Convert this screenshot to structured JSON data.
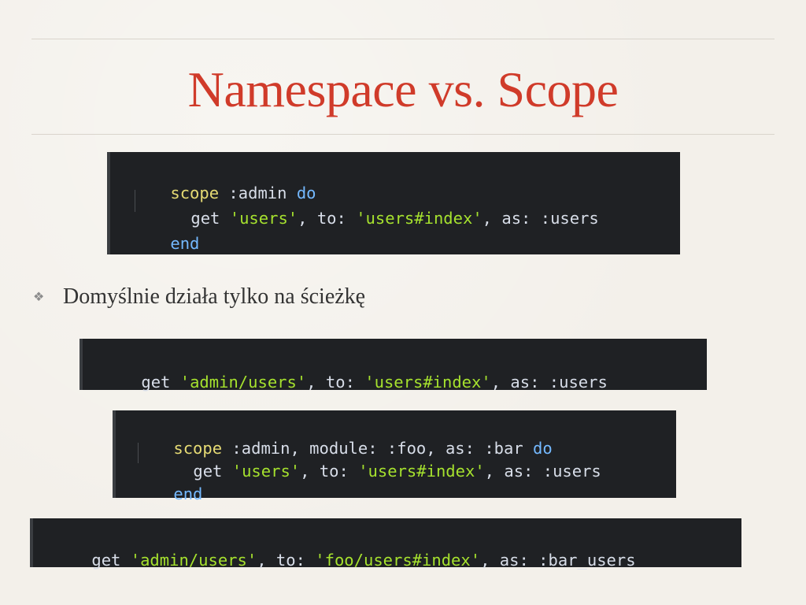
{
  "slide": {
    "title": "Namespace vs. Scope",
    "bullet": "Domyślnie działa tylko na ścieżkę",
    "bullet_marker": "❖"
  },
  "code1": {
    "line1": {
      "a": "scope",
      "b": " :admin ",
      "c": "do"
    },
    "line2": {
      "a": "get ",
      "b": "'users'",
      "c": ", to: ",
      "d": "'users#index'",
      "e": ", as: :users"
    },
    "line3": {
      "a": "end"
    }
  },
  "code2": {
    "line1": {
      "a": "get ",
      "b": "'admin/users'",
      "c": ", to: ",
      "d": "'users#index'",
      "e": ", as: :users"
    }
  },
  "code3": {
    "line1": {
      "a": "scope",
      "b": " :admin, module: :foo, as: :bar ",
      "c": "do"
    },
    "line2": {
      "a": "get ",
      "b": "'users'",
      "c": ", to: ",
      "d": "'users#index'",
      "e": ", as: :users"
    },
    "line3": {
      "a": "end"
    }
  },
  "code4": {
    "line1": {
      "a": "get ",
      "b": "'admin/users'",
      "c": ", to: ",
      "d": "'foo/users#index'",
      "e": ", as: :bar_users"
    }
  },
  "colors": {
    "title": "#d03b2a",
    "code_bg": "#1f2124",
    "string": "#a6e22e",
    "keyword": "#74b9ff",
    "scope": "#e6db74"
  }
}
